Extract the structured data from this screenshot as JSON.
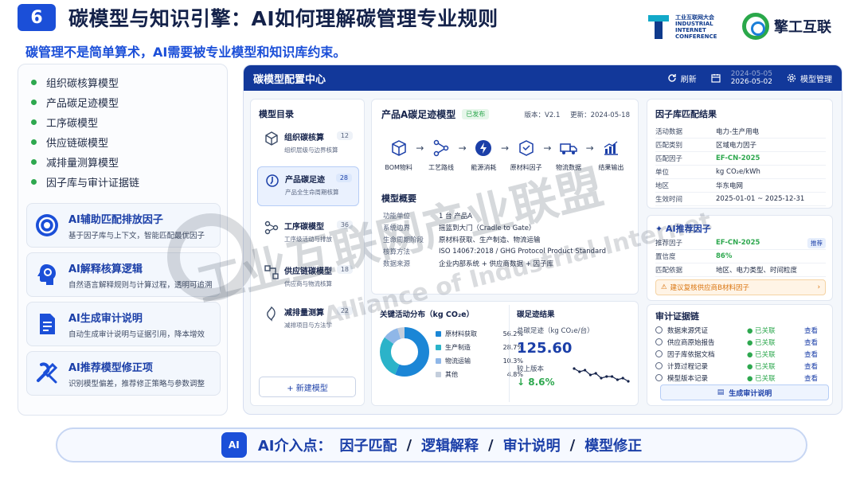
{
  "slide": {
    "number": "6",
    "title": "碳模型与知识引擎：AI如何理解碳管理专业规则",
    "subtitle": "碳管理不是简单算术，AI需要被专业模型和知识库约束。"
  },
  "logos": {
    "conference_lines": [
      "工业互联网大会",
      "INDUSTRIAL",
      "INTERNET",
      "CONFERENCE"
    ],
    "brand": "擎工互联"
  },
  "left_panel": {
    "bullets": [
      "组织碳核算模型",
      "产品碳足迹模型",
      "工序碳模型",
      "供应链碳模型",
      "减排量测算模型",
      "因子库与审计证据链"
    ],
    "ai_cards": [
      {
        "title": "AI辅助匹配排放因子",
        "desc": "基于因子库与上下文，智能匹配最优因子",
        "icon": "target-icon"
      },
      {
        "title": "AI解释核算逻辑",
        "desc": "自然语言解释规则与计算过程，透明可追溯",
        "icon": "ai-head-icon"
      },
      {
        "title": "AI生成审计说明",
        "desc": "自动生成审计说明与证据引用，降本增效",
        "icon": "document-icon"
      },
      {
        "title": "AI推荐模型修正项",
        "desc": "识别模型偏差，推荐修正策略与参数调整",
        "icon": "tools-icon"
      }
    ]
  },
  "window": {
    "title": "碳模型配置中心",
    "refresh": "刷新",
    "date_line1": "2024-05-05",
    "date_line2": "2026-05-02",
    "manage": "模型管理"
  },
  "catalog": {
    "heading": "模型目录",
    "items": [
      {
        "name": "组织碳核算",
        "desc": "组织层级与边界核算",
        "count": "12",
        "icon": "cube-icon"
      },
      {
        "name": "产品碳足迹",
        "desc": "产品全生命周期核算",
        "count": "28",
        "icon": "footprint-icon"
      },
      {
        "name": "工序碳模型",
        "desc": "工序级活动与排放",
        "count": "36",
        "icon": "process-icon"
      },
      {
        "name": "供应链碳模型",
        "desc": "供应商与物流核算",
        "count": "18",
        "icon": "supply-chain-icon"
      },
      {
        "name": "减排量测算",
        "desc": "减排项目与方法学",
        "count": "22",
        "icon": "reduction-icon"
      }
    ],
    "new_button": "+ 新建模型"
  },
  "model": {
    "name": "产品A碳足迹模型",
    "status": "已发布",
    "version": "版本：V2.1",
    "updated": "更新：2024-05-18",
    "flow": [
      {
        "label": "BOM物料",
        "icon": "bom-icon"
      },
      {
        "label": "工艺路线",
        "icon": "route-icon"
      },
      {
        "label": "能源消耗",
        "icon": "energy-icon"
      },
      {
        "label": "原材料因子",
        "icon": "material-icon"
      },
      {
        "label": "物流数据",
        "icon": "truck-icon"
      },
      {
        "label": "结果输出",
        "icon": "chart-icon"
      }
    ],
    "overview_heading": "模型概要",
    "overview": [
      {
        "k": "功能单位",
        "v": "1 台 产品A"
      },
      {
        "k": "系统边界",
        "v": "摇篮到大门（Cradle to Gate）"
      },
      {
        "k": "生命周期阶段",
        "v": "原材料获取、生产制造、物流运输"
      },
      {
        "k": "核算方法",
        "v": "ISO 14067:2018 / GHG Protocol Product Standard"
      },
      {
        "k": "数据来源",
        "v": "企业内部系统 + 供应商数据 + 因子库"
      }
    ]
  },
  "distribution": {
    "heading": "关键活动分布（kg CO₂e）",
    "items": [
      {
        "name": "原材料获取",
        "pct": "56.2%",
        "value": 56.2,
        "color": "#1b86d6"
      },
      {
        "name": "生产制造",
        "pct": "28.7%",
        "value": 28.7,
        "color": "#2bb3c9"
      },
      {
        "name": "物流运输",
        "pct": "10.3%",
        "value": 10.3,
        "color": "#8fb7e8"
      },
      {
        "name": "其他",
        "pct": "4.8%",
        "value": 4.8,
        "color": "#c4cedc"
      }
    ]
  },
  "result": {
    "heading": "碳足迹结果",
    "label": "总碳足迹（kg CO₂e/台）",
    "value": "125.60",
    "compare_label": "较上版本",
    "change": "8.6%",
    "trend": [
      8,
      6,
      7,
      4,
      5,
      2,
      3,
      3,
      1,
      2,
      0
    ]
  },
  "factor_match": {
    "heading": "因子库匹配结果",
    "rows": [
      {
        "k": "活动数据",
        "v": "电力-生产用电"
      },
      {
        "k": "匹配类别",
        "v": "区域电力因子"
      },
      {
        "k": "匹配因子",
        "v": "EF-CN-2025"
      },
      {
        "k": "单位",
        "v": "kg CO₂e/kWh"
      },
      {
        "k": "地区",
        "v": "华东电网"
      },
      {
        "k": "生效时间",
        "v": "2025-01-01 ~ 2025-12-31"
      }
    ]
  },
  "ai_recommend": {
    "heading": "AI推荐因子",
    "rows": [
      {
        "k": "推荐因子",
        "v": "EF-CN-2025"
      },
      {
        "k": "置信度",
        "v": "86%"
      },
      {
        "k": "匹配依据",
        "v": "地区、电力类型、时间粒度"
      }
    ],
    "badge": "推荐",
    "suggestion": "建议复核供应商B材料因子"
  },
  "audit_chain": {
    "heading": "审计证据链",
    "items": [
      "数据来源凭证",
      "供应商原始报告",
      "因子库依据文档",
      "计算过程记录",
      "模型版本记录"
    ],
    "status": "已关联",
    "view": "查看",
    "button": "生成审计说明"
  },
  "footer": {
    "chip": "AI",
    "prefix": "AI介入点：",
    "items": [
      "因子匹配",
      "逻辑解释",
      "审计说明",
      "模型修正"
    ],
    "separator": "/"
  },
  "watermark": {
    "cn": "工业互联网产业联盟",
    "en": "Alliance of Industrial Internet"
  }
}
